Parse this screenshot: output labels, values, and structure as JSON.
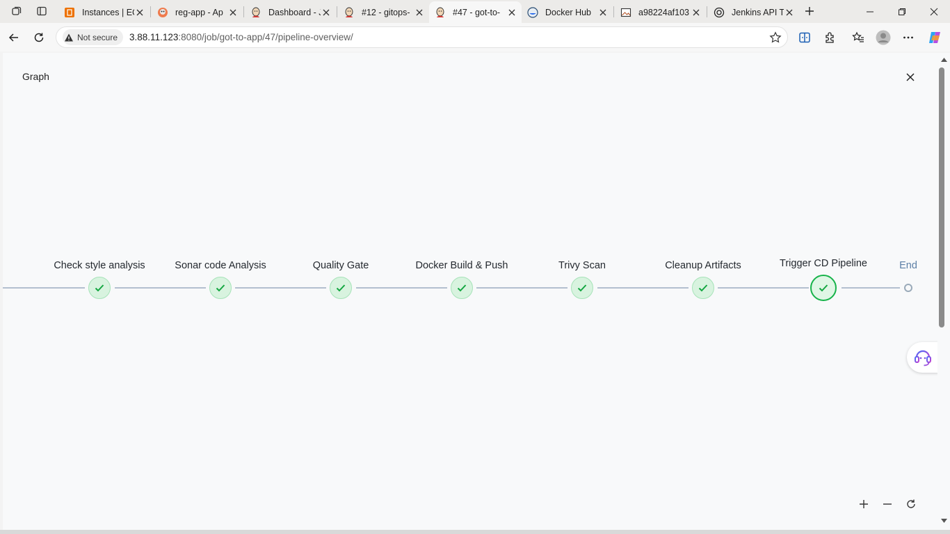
{
  "browser": {
    "tabs": [
      {
        "title": "Instances | EC",
        "icon": "aws-icon",
        "active": false
      },
      {
        "title": "reg-app - Ap",
        "icon": "argocd-icon",
        "active": false
      },
      {
        "title": "Dashboard - J",
        "icon": "jenkins-icon",
        "active": false
      },
      {
        "title": "#12 - gitops-",
        "icon": "jenkins-icon",
        "active": false
      },
      {
        "title": "#47 - got-to-",
        "icon": "jenkins-icon",
        "active": true
      },
      {
        "title": "Docker Hub",
        "icon": "docker-icon",
        "active": false
      },
      {
        "title": "a98224af103",
        "icon": "image-icon",
        "active": false
      },
      {
        "title": "Jenkins API To",
        "icon": "chatgpt-icon",
        "active": false
      }
    ],
    "security_label": "Not secure",
    "url_host": "3.88.11.123",
    "url_rest": ":8080/job/got-to-app/47/pipeline-overview/"
  },
  "page": {
    "title": "Graph"
  },
  "pipeline": {
    "stages": [
      {
        "label": "Check style analysis",
        "status": "success"
      },
      {
        "label": "Sonar code Analysis",
        "status": "success"
      },
      {
        "label": "Quality Gate",
        "status": "success"
      },
      {
        "label": "Docker Build & Push",
        "status": "success"
      },
      {
        "label": "Trivy Scan",
        "status": "success"
      },
      {
        "label": "Cleanup Artifacts",
        "status": "success"
      },
      {
        "label": "Trigger CD Pipeline",
        "status": "success",
        "selected": true
      }
    ],
    "end_label": "End"
  },
  "colors": {
    "success": "#17b34a",
    "end_label": "#5c7fa6",
    "track": "#b3bfcf"
  }
}
